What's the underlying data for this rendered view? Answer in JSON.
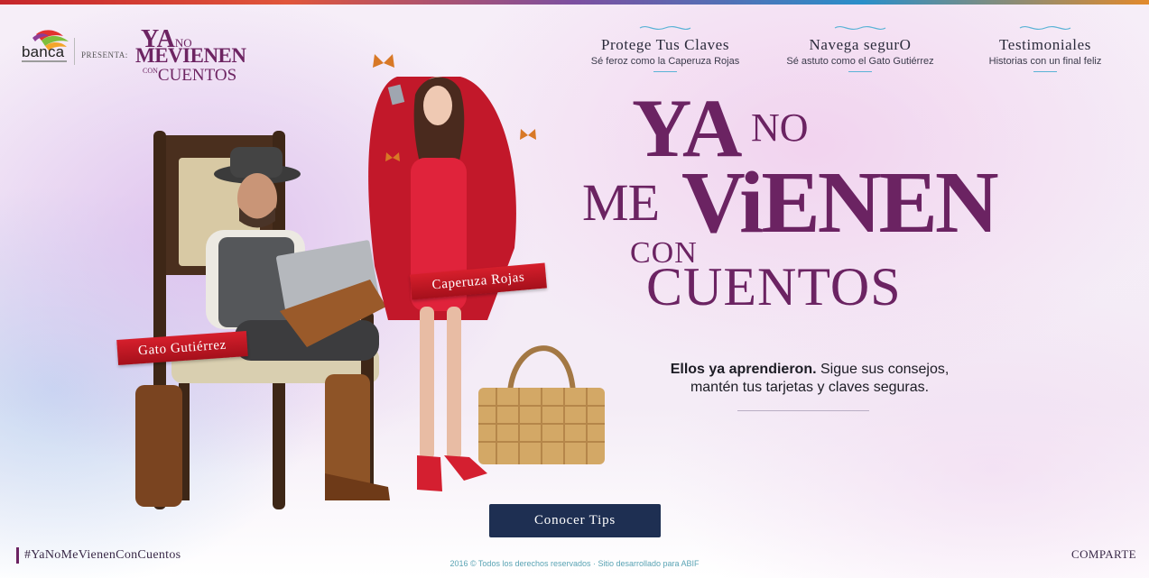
{
  "brand": {
    "logo_text": "banca",
    "presents_label": "PRESENTA:",
    "campaign_mini": {
      "line1": "YA",
      "line1_small": "NO",
      "line2": "MEVIENEN",
      "line3_small": "CON",
      "line3": "CUENTOS"
    }
  },
  "nav": {
    "items": [
      {
        "title": "Protege Tus Claves",
        "subtitle": "Sé feroz como la Caperuza Rojas"
      },
      {
        "title": "Navega segurO",
        "subtitle": "Sé astuto como el Gato Gutiérrez"
      },
      {
        "title": "Testimoniales",
        "subtitle": "Historias con un final feliz"
      }
    ]
  },
  "hero": {
    "line_ya": "YA",
    "line_no": "NO",
    "line_me": "ME",
    "line_vienen": "ViENEN",
    "line_con": "CON",
    "line_cuentos": "CUENTOS"
  },
  "characters": {
    "gato_label": "Gato Gutiérrez",
    "caperuza_label": "Caperuza Rojas"
  },
  "tagline": {
    "bold": "Ellos ya aprendieron.",
    "rest": " Sigue sus consejos,",
    "line2": "mantén tus tarjetas y claves seguras."
  },
  "cta": {
    "label": "Conocer Tips"
  },
  "footer": {
    "hashtag": "#YaNoMeVienenConCuentos",
    "copyright": "2016 © Todos los derechos reservados · Sitio desarrollado para ABIF",
    "share": "COMPARTE"
  },
  "colors": {
    "brand_purple": "#6b2362",
    "cta_navy": "#1e2f52",
    "banner_red": "#c8182a",
    "nav_accent": "#5ab3d6"
  }
}
